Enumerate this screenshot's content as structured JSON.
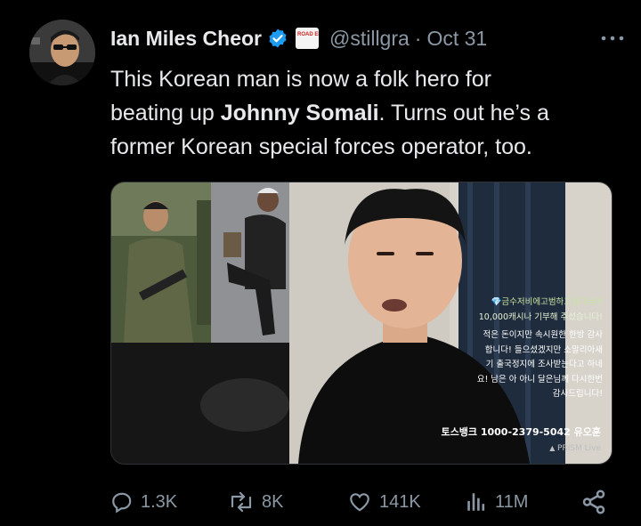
{
  "author": {
    "name": "Ian Miles Cheor",
    "handle": "@stillgra",
    "date": "Oct 31",
    "badge_text": "ROAD ELECTION"
  },
  "tweet": {
    "line1": "This Korean man is now a folk hero for",
    "line2_pre": "beating up ",
    "line2_bold": "Johnny Somali",
    "line2_post": ".  Turns out he’s a",
    "line3": "former Korean special forces operator, too."
  },
  "overlay": {
    "donation_lines": [
      "💎금수저비에고범하고싶다님이",
      "10,000캐시나 기부해 주셨습니다!",
      "적은 돈이지만 속시원한 한방 감사",
      "합니다! 들으셨겠지만 소말리아새",
      "기 출국정지에 조사받는다고 하네",
      "요! 남은 아 아니 달은님께 다시한번",
      "감사드립니다!"
    ],
    "bank": "토스뱅크 1000-2379-5042 유오훈",
    "watermark": "PRISM Live"
  },
  "actions": {
    "replies": "1.3K",
    "reposts": "8K",
    "likes": "141K",
    "views": "11M"
  },
  "colors": {
    "background": "#000000",
    "text": "#e7e9ea",
    "muted": "#8b98a5",
    "verified": "#1d9bf0"
  }
}
